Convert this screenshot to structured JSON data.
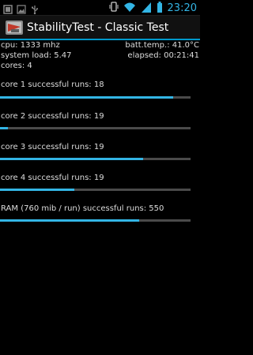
{
  "status_bar": {
    "time": "23:20",
    "left_icons": [
      "notification-icon",
      "image-icon",
      "usb-icon"
    ],
    "right_icons": [
      "vibrate-icon",
      "wifi-icon",
      "signal-icon",
      "battery-icon"
    ]
  },
  "app": {
    "title": "StabilityTest - Classic Test",
    "icon": "app-logo-icon"
  },
  "info": {
    "cpu": "cpu: 1333 mhz",
    "batt_temp": "batt.temp.: 41.0°C",
    "system_load": "system load: 5.47",
    "elapsed": "elapsed: 00:21:41",
    "cores": "cores: 4"
  },
  "runs": [
    {
      "label": "core 1 successful runs: 18",
      "progress_fraction": 0.91
    },
    {
      "label": "core 2 successful runs: 19",
      "progress_fraction": 0.04
    },
    {
      "label": "core 3 successful runs: 19",
      "progress_fraction": 0.75
    },
    {
      "label": "core 4 successful runs: 19",
      "progress_fraction": 0.39
    },
    {
      "label": "RAM (760 mib / run) successful runs: 550",
      "progress_fraction": 0.73
    }
  ],
  "colors": {
    "accent": "#33b5e5",
    "track": "#4a4a4a",
    "background": "#000000"
  }
}
